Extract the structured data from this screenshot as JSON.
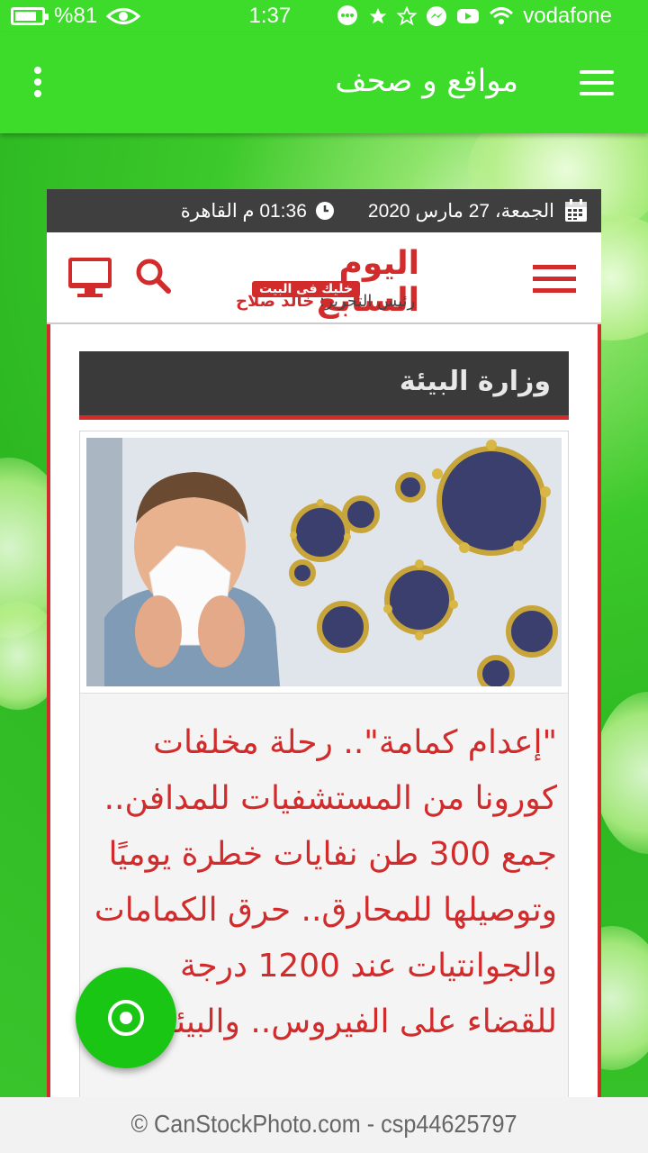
{
  "status_bar": {
    "battery": "%81",
    "battery_level": 0.81,
    "time": "1:37",
    "carrier": "vodafone"
  },
  "app_bar": {
    "title": "مواقع و صحف",
    "menu_icon": "hamburger-icon",
    "overflow_icon": "more-vert-icon",
    "color": "#3ddc2a"
  },
  "site": {
    "date": "الجمعة، 27 مارس 2020",
    "time": "01:36 م القاهرة",
    "logo_main": "اليوم السابع",
    "logo_tagline": "خليك فى البيت",
    "editor_label": "رئيس التحرير: ",
    "editor_name": "خالد صلاح",
    "accent": "#d22b2b"
  },
  "section": {
    "title": "وزارة البيئة"
  },
  "article": {
    "headline": "\"إعدام كمامة\".. رحلة مخلفات كورونا من المستشفيات للمدافن.. جمع 300 طن نفايات خطرة يوميًا وتوصيلها للمحارق.. حرق الكمامات والجوانتيات عند 1200 درجة للقضاء على الفيروس.. والبيئة"
  },
  "watermark": {
    "text": "© CanStockPhoto.com - csp44625797"
  }
}
